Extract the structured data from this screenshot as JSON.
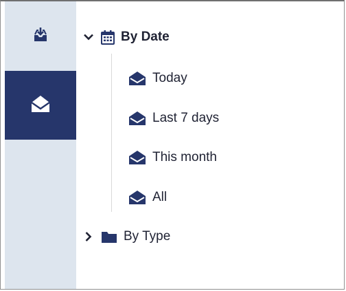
{
  "sidebar": {
    "import_icon": "inbox-download-icon",
    "mail_icon": "envelope-open-icon",
    "active_color": "#26366b",
    "background_color": "#dde5ee"
  },
  "tree": {
    "by_date": {
      "label": "By Date",
      "expanded": true,
      "icon": "calendar-icon",
      "children": [
        {
          "label": "Today",
          "icon": "envelope-open-icon"
        },
        {
          "label": "Last 7 days",
          "icon": "envelope-open-icon"
        },
        {
          "label": "This month",
          "icon": "envelope-open-icon"
        },
        {
          "label": "All",
          "icon": "envelope-open-icon"
        }
      ]
    },
    "by_type": {
      "label": "By Type",
      "expanded": false,
      "icon": "folder-icon"
    }
  }
}
